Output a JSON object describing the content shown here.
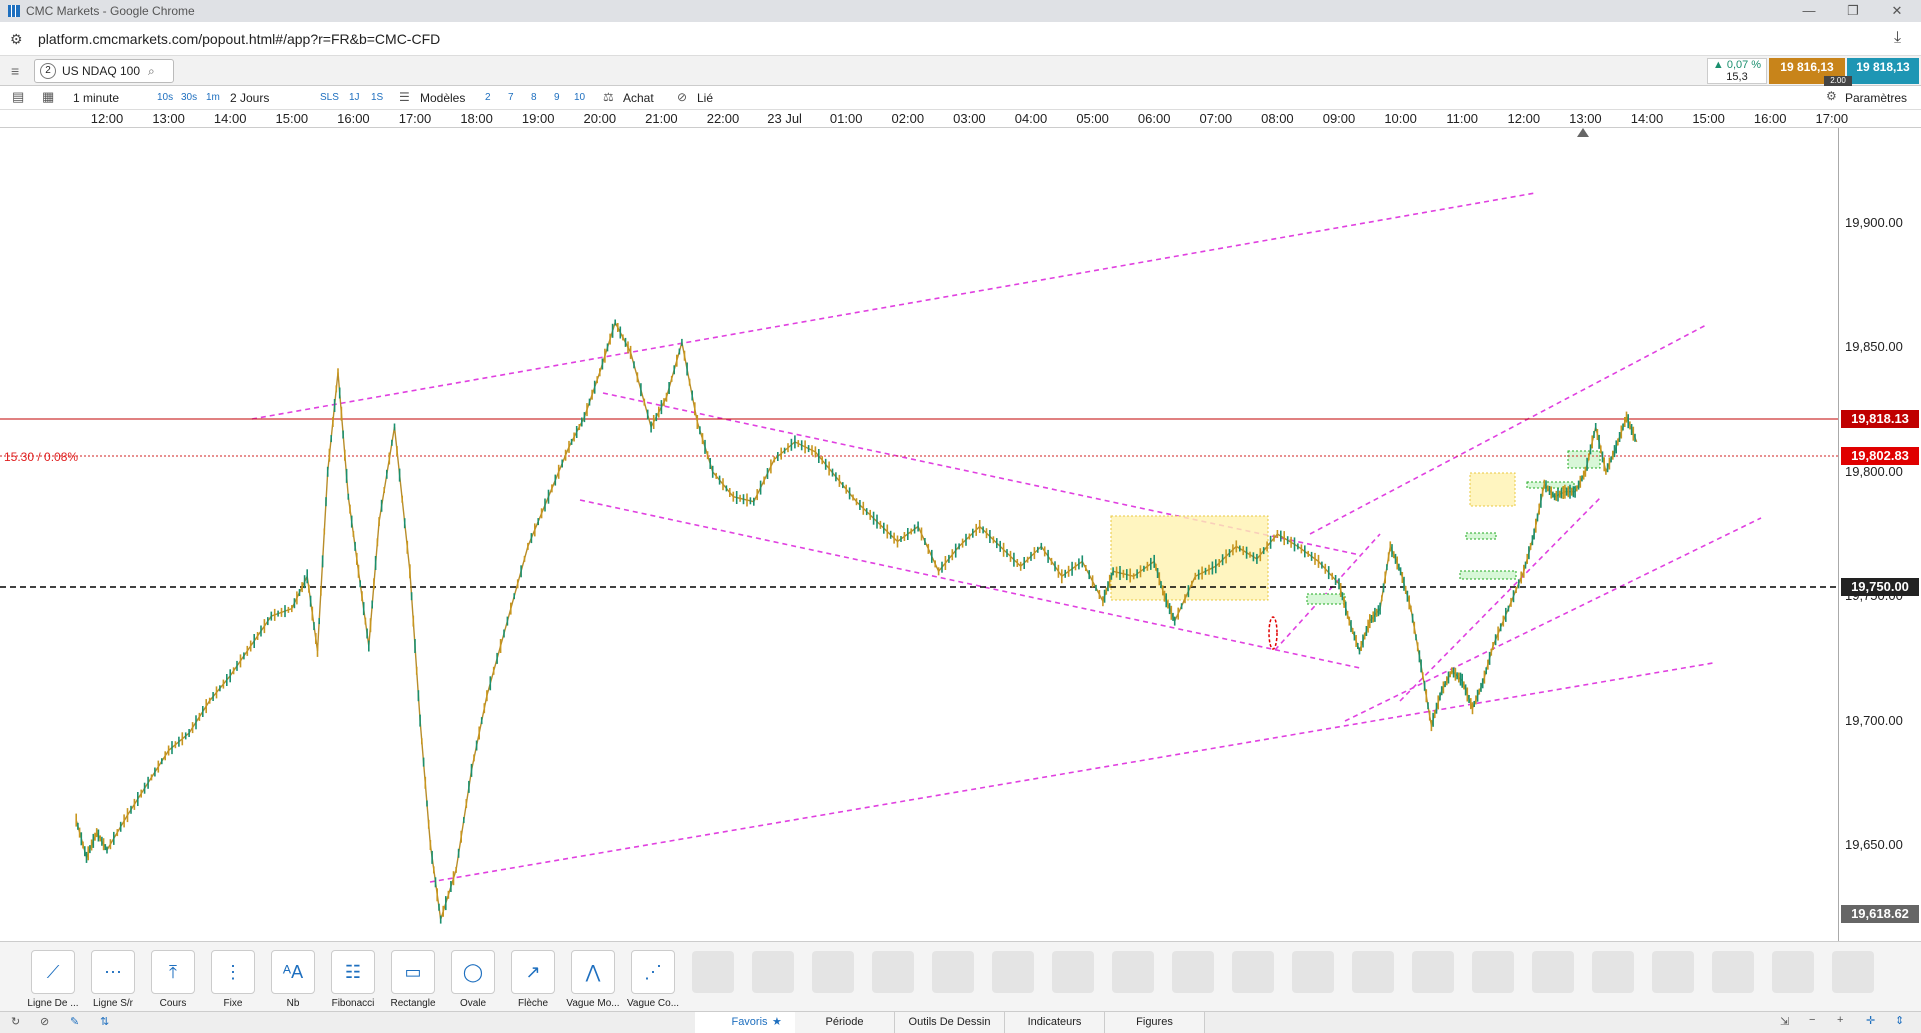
{
  "browser": {
    "title": "CMC Markets - Google Chrome",
    "url": "platform.cmcmarkets.com/popout.html#/app?r=FR&b=CMC-CFD"
  },
  "instrument": {
    "badge": "2",
    "name": "US NDAQ 100",
    "change_pct": "▲ 0,07 %",
    "change_pts": "15,3",
    "sell": "19 816,13",
    "buy": "19 818,13",
    "spread": "2.00"
  },
  "toolbar": {
    "interval": "1 minute",
    "q10s": "10s",
    "q30s": "30s",
    "q1m": "1m",
    "range": "2 Jours",
    "sls": "SLS",
    "r1j": "1J",
    "r1s": "1S",
    "models": "Modèles",
    "n2": "2",
    "n7": "7",
    "n8": "8",
    "n9": "9",
    "n10": "10",
    "buy": "Achat",
    "linked": "Lié",
    "settings": "Paramètres"
  },
  "time_axis": [
    "12:00",
    "13:00",
    "14:00",
    "15:00",
    "16:00",
    "17:00",
    "18:00",
    "19:00",
    "20:00",
    "21:00",
    "22:00",
    "23 Jul",
    "01:00",
    "02:00",
    "03:00",
    "04:00",
    "05:00",
    "06:00",
    "07:00",
    "08:00",
    "09:00",
    "10:00",
    "11:00",
    "12:00",
    "13:00",
    "14:00",
    "15:00",
    "16:00",
    "17:00"
  ],
  "chart_data": {
    "type": "candlestick",
    "instrument": "US NDAQ 100",
    "interval": "1 minute",
    "y_ticks": [
      "19,900.00",
      "19,850.00",
      "19,800.00",
      "19,750.00",
      "19,700.00",
      "19,650.00"
    ],
    "ylim": [
      19618.62,
      19917
    ],
    "price_labels": {
      "current": "19,818.13",
      "bid": "19,802.83",
      "level": "19,750.00",
      "low": "19,618.62"
    },
    "change_label": "15.30 / 0.08%",
    "colors": {
      "up": "#1a8f6e",
      "down": "#c8961e",
      "trendline": "#e040e0",
      "current_line": "#c00000",
      "zone": "#fff3b0"
    },
    "path": [
      [
        "11:30",
        19660
      ],
      [
        "11:40",
        19645
      ],
      [
        "11:50",
        19655
      ],
      [
        "12:00",
        19648
      ],
      [
        "12:20",
        19662
      ],
      [
        "12:40",
        19675
      ],
      [
        "13:00",
        19688
      ],
      [
        "13:20",
        19695
      ],
      [
        "13:40",
        19708
      ],
      [
        "14:00",
        19718
      ],
      [
        "14:20",
        19730
      ],
      [
        "14:40",
        19742
      ],
      [
        "15:00",
        19745
      ],
      [
        "15:15",
        19758
      ],
      [
        "15:25",
        19728
      ],
      [
        "15:35",
        19800
      ],
      [
        "15:45",
        19840
      ],
      [
        "15:55",
        19790
      ],
      [
        "16:05",
        19760
      ],
      [
        "16:15",
        19730
      ],
      [
        "16:25",
        19780
      ],
      [
        "16:40",
        19818
      ],
      [
        "16:55",
        19760
      ],
      [
        "17:05",
        19700
      ],
      [
        "17:15",
        19650
      ],
      [
        "17:25",
        19620
      ],
      [
        "17:40",
        19640
      ],
      [
        "17:55",
        19680
      ],
      [
        "18:10",
        19710
      ],
      [
        "18:30",
        19740
      ],
      [
        "18:50",
        19770
      ],
      [
        "19:10",
        19790
      ],
      [
        "19:30",
        19810
      ],
      [
        "19:45",
        19822
      ],
      [
        "20:00",
        19840
      ],
      [
        "20:15",
        19860
      ],
      [
        "20:30",
        19848
      ],
      [
        "20:50",
        19818
      ],
      [
        "21:05",
        19830
      ],
      [
        "21:20",
        19852
      ],
      [
        "21:35",
        19820
      ],
      [
        "21:50",
        19800
      ],
      [
        "22:10",
        19790
      ],
      [
        "22:30",
        19788
      ],
      [
        "22:50",
        19805
      ],
      [
        "23:10",
        19812
      ],
      [
        "23:30",
        19808
      ],
      [
        "23:50",
        19798
      ],
      [
        "00:10",
        19788
      ],
      [
        "00:30",
        19780
      ],
      [
        "00:50",
        19772
      ],
      [
        "01:10",
        19778
      ],
      [
        "01:30",
        19760
      ],
      [
        "01:50",
        19770
      ],
      [
        "02:10",
        19778
      ],
      [
        "02:30",
        19770
      ],
      [
        "02:50",
        19762
      ],
      [
        "03:10",
        19770
      ],
      [
        "03:30",
        19758
      ],
      [
        "03:50",
        19764
      ],
      [
        "04:10",
        19748
      ],
      [
        "04:20",
        19760
      ],
      [
        "04:40",
        19758
      ],
      [
        "05:00",
        19764
      ],
      [
        "05:10",
        19750
      ],
      [
        "05:20",
        19740
      ],
      [
        "05:40",
        19758
      ],
      [
        "06:00",
        19762
      ],
      [
        "06:20",
        19770
      ],
      [
        "06:40",
        19765
      ],
      [
        "07:00",
        19775
      ],
      [
        "07:20",
        19770
      ],
      [
        "07:40",
        19764
      ],
      [
        "08:00",
        19755
      ],
      [
        "08:10",
        19740
      ],
      [
        "08:20",
        19728
      ],
      [
        "08:30",
        19740
      ],
      [
        "08:40",
        19745
      ],
      [
        "08:50",
        19770
      ],
      [
        "09:00",
        19760
      ],
      [
        "09:10",
        19745
      ],
      [
        "09:20",
        19722
      ],
      [
        "09:30",
        19698
      ],
      [
        "09:40",
        19712
      ],
      [
        "09:50",
        19720
      ],
      [
        "10:00",
        19716
      ],
      [
        "10:10",
        19705
      ],
      [
        "10:20",
        19715
      ],
      [
        "10:30",
        19730
      ],
      [
        "10:45",
        19745
      ],
      [
        "11:00",
        19760
      ],
      [
        "11:10",
        19775
      ],
      [
        "11:20",
        19795
      ],
      [
        "11:30",
        19790
      ],
      [
        "11:40",
        19792
      ],
      [
        "11:50",
        19792
      ],
      [
        "12:00",
        19800
      ],
      [
        "12:10",
        19818
      ],
      [
        "12:20",
        19800
      ],
      [
        "12:30",
        19810
      ],
      [
        "12:40",
        19822
      ],
      [
        "12:50",
        19812
      ]
    ]
  },
  "tools": [
    {
      "label": "Ligne De ...",
      "icon": "trend-line-icon"
    },
    {
      "label": "Ligne S/r",
      "icon": "sr-line-icon"
    },
    {
      "label": "Cours",
      "icon": "price-icon"
    },
    {
      "label": "Fixe",
      "icon": "vertical-line-icon"
    },
    {
      "label": "Nb",
      "icon": "text-icon"
    },
    {
      "label": "Fibonacci",
      "icon": "fibonacci-icon"
    },
    {
      "label": "Rectangle",
      "icon": "rectangle-icon"
    },
    {
      "label": "Ovale",
      "icon": "oval-icon"
    },
    {
      "label": "Flèche",
      "icon": "arrow-icon"
    },
    {
      "label": "Vague Mo...",
      "icon": "wave-icon"
    },
    {
      "label": "Vague Co...",
      "icon": "corrective-wave-icon"
    }
  ],
  "bottom_tabs": [
    "Favoris",
    "Période",
    "Outils De Dessin",
    "Indicateurs",
    "Figures"
  ]
}
